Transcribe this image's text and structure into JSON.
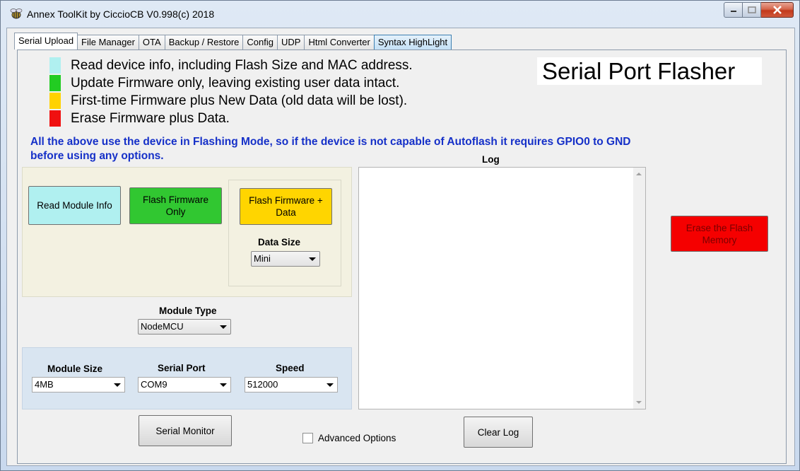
{
  "window": {
    "title": "Annex ToolKit by CiccioCB V0.998(c) 2018"
  },
  "tabs": [
    {
      "label": "Serial Upload"
    },
    {
      "label": "File Manager"
    },
    {
      "label": "OTA"
    },
    {
      "label": "Backup / Restore"
    },
    {
      "label": "Config"
    },
    {
      "label": "UDP"
    },
    {
      "label": "Html Converter"
    },
    {
      "label": "Syntax HighLight"
    }
  ],
  "legend": [
    {
      "color": "#b0f0f0",
      "text": "Read device info, including Flash Size and MAC address."
    },
    {
      "color": "#22cc22",
      "text": "Update Firmware only, leaving existing user data intact."
    },
    {
      "color": "#ffd200",
      "text": "First-time Firmware plus New Data (old data will be lost)."
    },
    {
      "color": "#f01010",
      "text": "Erase Firmware plus Data."
    }
  ],
  "banner": "Serial Port Flasher",
  "note": "All the above use the device in Flashing Mode, so if the device is  not capable of Autoflash it requires GPIO0 to GND before using any options.",
  "buttons": {
    "read_info": {
      "label": "Read Module Info",
      "color": "#b0f0f0"
    },
    "flash_fw": {
      "label": "Flash Firmware Only",
      "color": "#31c731"
    },
    "flash_fw_data": {
      "label": "Flash Firmware + Data",
      "color": "#ffd500"
    },
    "erase": {
      "label": "Erase the Flash Memory",
      "color": "#f50000"
    },
    "serial_monitor": {
      "label": "Serial Monitor"
    },
    "clear_log": {
      "label": "Clear Log"
    }
  },
  "data_size": {
    "label": "Data Size",
    "value": "Mini"
  },
  "module_type": {
    "label": "Module Type",
    "value": "NodeMCU"
  },
  "module_size": {
    "label": "Module Size",
    "value": "4MB"
  },
  "serial_port": {
    "label": "Serial Port",
    "value": "COM9"
  },
  "speed": {
    "label": "Speed",
    "value": "512000"
  },
  "log": {
    "label": "Log",
    "content": ""
  },
  "advanced_options": {
    "label": "Advanced Options",
    "checked": false
  }
}
